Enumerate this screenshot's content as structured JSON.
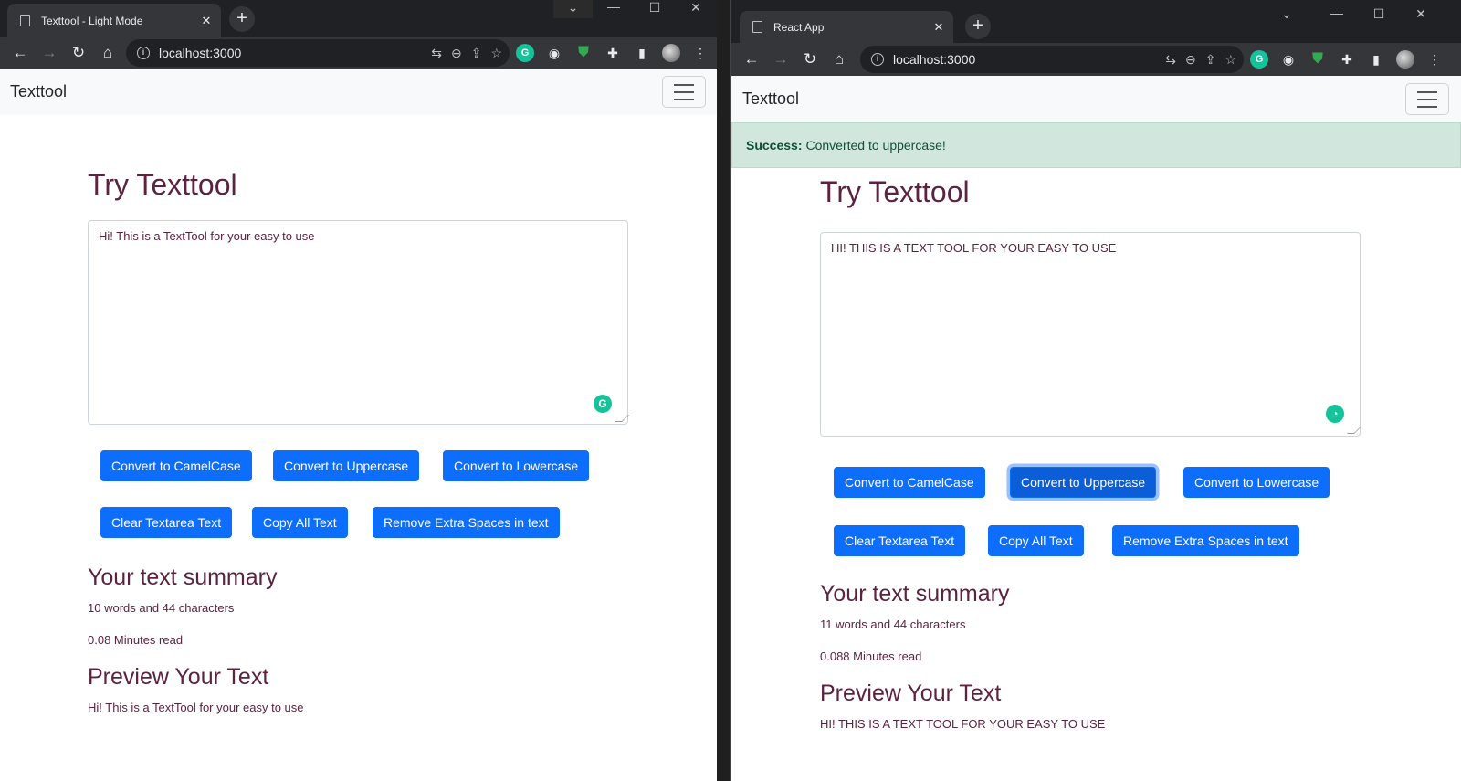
{
  "left": {
    "tab_title": "Texttool - Light Mode",
    "url": "localhost:3000",
    "brand": "Texttool",
    "heading": "Try Texttool",
    "textarea_value": "Hi! This is a TextTool for your easy to use",
    "buttons": [
      "Convert to CamelCase",
      "Convert to Uppercase",
      "Convert to Lowercase",
      "Clear Textarea Text",
      "Copy All Text",
      "Remove Extra Spaces in text"
    ],
    "summary_heading": "Your text summary",
    "summary_counts": "10 words and 44 characters",
    "read_time": "0.08 Minutes read",
    "preview_heading": "Preview Your Text",
    "preview_text": "Hi! This is a TextTool for your easy to use"
  },
  "right": {
    "tab_title": "React App",
    "url": "localhost:3000",
    "brand": "Texttool",
    "alert_label": "Success:",
    "alert_message": "Converted to uppercase!",
    "heading": "Try Texttool",
    "textarea_value": "HI! THIS IS A TEXT TOOL FOR YOUR EASY TO USE",
    "buttons": [
      "Convert to CamelCase",
      "Convert to Uppercase",
      "Convert to Lowercase",
      "Clear Textarea Text",
      "Copy All Text",
      "Remove Extra Spaces in text"
    ],
    "summary_heading": "Your text summary",
    "summary_counts": "11 words and 44 characters",
    "read_time": "0.088 Minutes read",
    "preview_heading": "Preview Your Text",
    "preview_text": "HI! THIS IS A TEXT TOOL FOR YOUR EASY TO USE"
  },
  "icons": {
    "back": "arrow-left-icon",
    "forward": "arrow-right-icon",
    "reload": "reload-icon",
    "home": "home-icon",
    "grammarly": "grammarly-icon"
  },
  "colors": {
    "primary": "#0d6efd",
    "text": "#5b2340",
    "navbar": "#f8f9fa",
    "alert_bg": "#d1e7dd",
    "alert_text": "#0f5132"
  }
}
